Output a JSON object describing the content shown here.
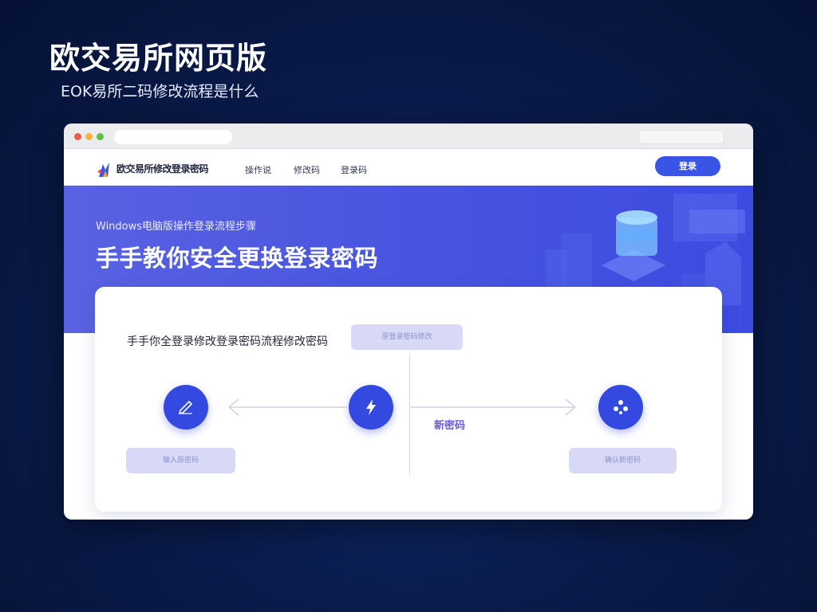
{
  "headline": "欧交易所网页版",
  "subline": "EOK易所二码修改流程是什么",
  "window": {
    "titlebar": {
      "right_hint": ""
    },
    "nav": {
      "brand": "欧交易所修改登录密码",
      "items": [
        "操作说",
        "修改码",
        "登录码"
      ],
      "login_label": "登录"
    },
    "hero": {
      "small_text": "Windows电脑版操作登录流程步骤",
      "title": "手手教你安全更换登录密码"
    },
    "card": {
      "title": "手手你全登录修改登录密码流程修改密码",
      "top_pill": "原登录密码修改",
      "left_pill": "输入原密码",
      "right_pill": "确认新密码",
      "mid_label": "新密码"
    }
  },
  "colors": {
    "accent": "#3a55e6",
    "hero_start": "#5a62e2",
    "hero_end": "#3d4be0",
    "pill": "#d7d9f7",
    "background": "#0a1c4d"
  },
  "icons": {
    "logo": "flame-logo-icon",
    "circle1": "pen-icon",
    "circle2": "lightning-icon",
    "circle3": "nodes-icon"
  }
}
